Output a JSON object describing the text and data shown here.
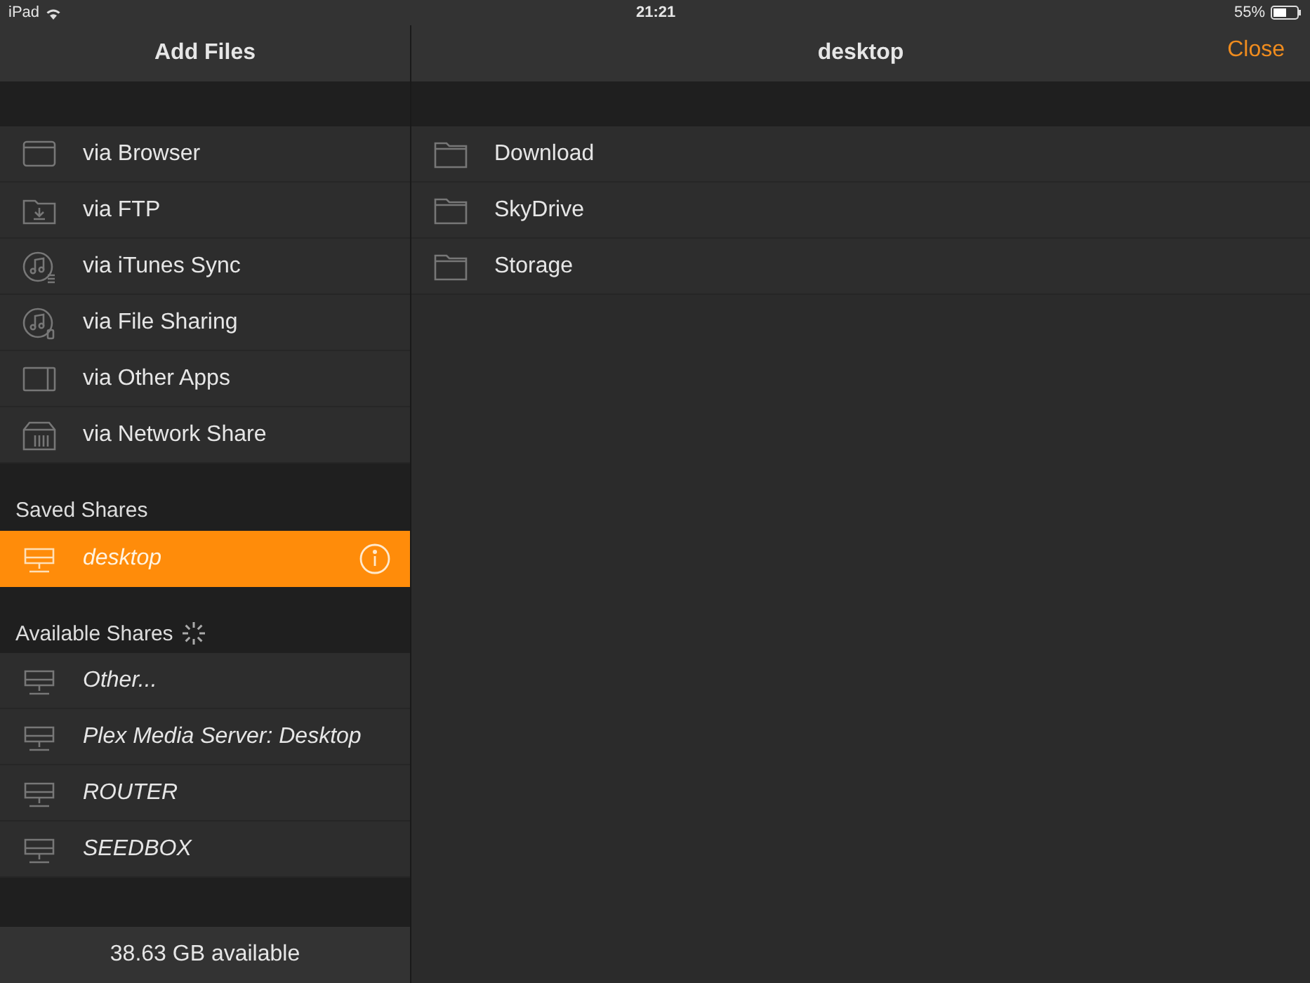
{
  "status_bar": {
    "device": "iPad",
    "time": "21:21",
    "battery": "55%"
  },
  "sidebar": {
    "title": "Add Files",
    "sources": [
      {
        "kind": "browser",
        "label": "via Browser"
      },
      {
        "kind": "ftp",
        "label": "via FTP"
      },
      {
        "kind": "itunes",
        "label": "via iTunes Sync"
      },
      {
        "kind": "filesharing",
        "label": "via File Sharing"
      },
      {
        "kind": "apps",
        "label": "via Other Apps"
      },
      {
        "kind": "network",
        "label": "via Network Share"
      }
    ],
    "saved_shares": {
      "heading": "Saved Shares",
      "items": [
        {
          "label": "desktop",
          "selected": true
        }
      ]
    },
    "available_shares": {
      "heading": "Available Shares",
      "loading": true,
      "items": [
        {
          "label": "Other...",
          "selected": false
        },
        {
          "label": "Plex Media Server: Desktop",
          "selected": false
        },
        {
          "label": "ROUTER",
          "selected": false
        },
        {
          "label": "SEEDBOX",
          "selected": false
        }
      ]
    },
    "footer": "38.63 GB available"
  },
  "content": {
    "title": "desktop",
    "close": "Close",
    "folders": [
      "Download",
      "SkyDrive",
      "Storage"
    ]
  }
}
